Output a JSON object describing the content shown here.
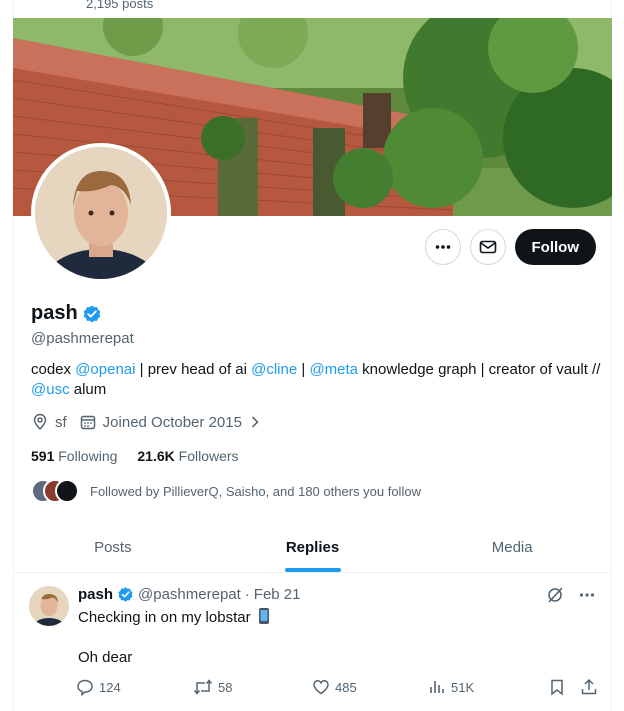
{
  "topbar": {
    "posts_count": "2,195 posts"
  },
  "profile": {
    "display_name": "pash",
    "handle": "@pashmerepat",
    "bio": {
      "t1": "codex ",
      "m1": "@openai",
      "t2": " | prev head of ai ",
      "m2": "@cline",
      "t3": " | ",
      "m3": "@meta",
      "t4": " knowledge graph | creator of vault // ",
      "m4": "@usc",
      "t5": " alum"
    },
    "location": "sf",
    "joined": "Joined October 2015",
    "following_count": "591",
    "following_label": "Following",
    "followers_count": "21.6K",
    "followers_label": "Followers",
    "followed_by": "Followed by PillieverQ, Saisho, and 180 others you follow"
  },
  "actions": {
    "follow_label": "Follow"
  },
  "tabs": [
    {
      "label": "Posts",
      "active": false
    },
    {
      "label": "Replies",
      "active": true
    },
    {
      "label": "Media",
      "active": false
    }
  ],
  "tweet": {
    "name": "pash",
    "handle": "@pashmerepat",
    "separator": "·",
    "date": "Feb 21",
    "line1": "Checking in on my lobstar",
    "line2": "Oh dear",
    "replies": "124",
    "reposts": "58",
    "likes": "485",
    "views": "51K"
  },
  "colors": {
    "accent": "#1d9bf0",
    "text": "#0f1419",
    "muted": "#536471",
    "follow_bg": "#0f1419"
  }
}
